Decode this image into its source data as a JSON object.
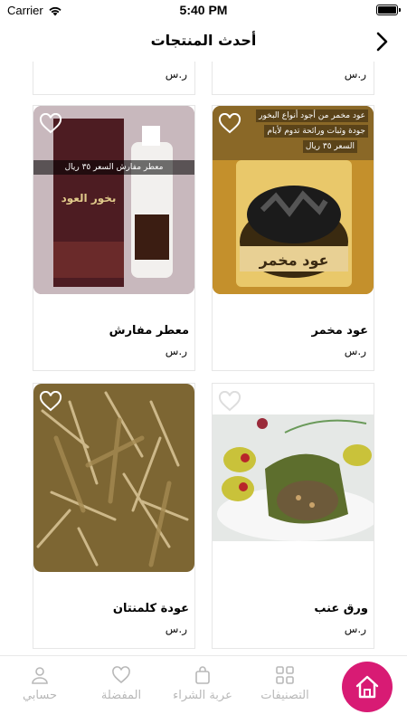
{
  "status": {
    "carrier": "Carrier",
    "time": "5:40 PM"
  },
  "nav": {
    "title": "أحدث المنتجات"
  },
  "currency": "ر.س",
  "products": [
    {
      "name": "",
      "price": "ر.س"
    },
    {
      "name": "",
      "price": "ر.س"
    },
    {
      "name": "عود مخمر",
      "price": "ر.س",
      "overlay": [
        "عود مخمر من أجود أنواع البخور",
        "جودة وثبات ورائحة تدوم لأيام",
        "السعر ٣٥ ريال"
      ],
      "label_text": "عود مخمر"
    },
    {
      "name": "معطر مفارش",
      "price": "ر.س",
      "overlay": [
        "معطر مفارش السعر ٣٥ ريال"
      ],
      "label_text": "بخور العود"
    },
    {
      "name": "ورق عنب",
      "price": "ر.س"
    },
    {
      "name": "عودة كلمنتان",
      "price": "ر.س"
    }
  ],
  "tabs": [
    {
      "label": "التصنيفات",
      "icon": "grid-icon"
    },
    {
      "label": "عربة الشراء",
      "icon": "shopping-bag-icon"
    },
    {
      "label": "المفضلة",
      "icon": "heart-icon"
    },
    {
      "label": "حسابي",
      "icon": "user-icon"
    }
  ],
  "colors": {
    "accent": "#d81b74",
    "tab_inactive": "#b8b8b8",
    "card_border": "#e6e6e6"
  }
}
